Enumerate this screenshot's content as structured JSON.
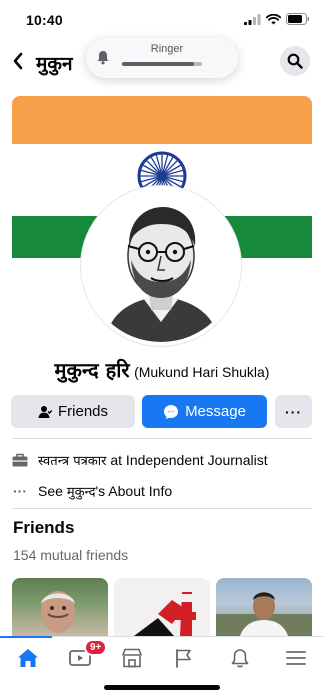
{
  "status_bar": {
    "time": "10:40"
  },
  "header": {
    "title": "मुकुन"
  },
  "ringer_overlay": {
    "label": "Ringer",
    "volume_fraction": 0.9
  },
  "profile": {
    "name_hindi": "मुकुन्द हरि",
    "name_english": "(Mukund Hari Shukla)"
  },
  "actions": {
    "friends_label": "Friends",
    "message_label": "Message",
    "more_label": "···"
  },
  "intro": {
    "work_hindi": "स्वतन्त्र पत्रकार",
    "work_rest": " at Independent Journalist",
    "about_prefix": "See ",
    "about_hindi": "मुकुन्द",
    "about_suffix": "'s About Info",
    "about_dots": "···"
  },
  "friends_section": {
    "title": "Friends",
    "mutual": "154 mutual friends"
  },
  "tabbar": {
    "video_badge": "9+",
    "active_tab": "home"
  },
  "colors": {
    "accent": "#1877f2",
    "badge": "#e41e3f",
    "saffron": "#f6a04a",
    "green": "#16893b",
    "chakra": "#1f3a93"
  },
  "icons": [
    "back-arrow-icon",
    "search-icon",
    "bell-icon",
    "person-icon",
    "messenger-icon",
    "briefcase-icon",
    "more-icon",
    "home-icon",
    "video-icon",
    "marketplace-icon",
    "flag-icon",
    "notifications-icon",
    "menu-icon"
  ]
}
